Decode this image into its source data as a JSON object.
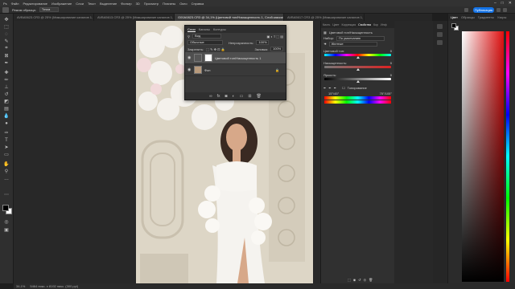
{
  "menu_bar": {
    "items": [
      "Ps",
      "Файл",
      "Редактирование",
      "Изображение",
      "Слои",
      "Текст",
      "Выделение",
      "Фильтр",
      "3D",
      "Просмотр",
      "Плагины",
      "Окно",
      "Справка"
    ]
  },
  "options_bar": {
    "mode_label": "Режим образца:",
    "mode_value": "Точка",
    "publish_label": "Публикация"
  },
  "tabs": [
    {
      "label": "AVBA5623.CR3 @ 25% (Микширование каналов 1, Слой-маска/16) *",
      "active": false
    },
    {
      "label": "AVBA5613.CR3 @ 25% (Микширование каналов 1, Слой-маска/16) *",
      "active": false
    },
    {
      "label": "G00A0823.CR3 @ 34,1% (Цветовой тон/Насыщенность 1, Слой-маска/16) *",
      "active": true
    },
    {
      "label": "AVBA5617.CR3 @ 25% (Микширование каналов 1, Слой-маска/16) *",
      "active": false
    }
  ],
  "layers_panel": {
    "tabs": [
      "Слои",
      "Каналы",
      "Контуры"
    ],
    "filter_label": "Вид",
    "blend_mode": "Обычные",
    "opacity_label": "Непрозрачность:",
    "opacity_value": "100%",
    "lock_label": "Закрепить:",
    "fill_label": "Заливка:",
    "fill_value": "100%",
    "layers": [
      {
        "name": "Цветовой тон/Насыщенность 1",
        "selected": true
      },
      {
        "name": "Фон",
        "selected": false
      }
    ]
  },
  "properties_panel": {
    "tabs": [
      "Кисть",
      "Цвет",
      "Коррекция",
      "Свойства",
      "Кор",
      "Инф"
    ],
    "title": "Цветовой тон/Насыщенность",
    "preset_label": "Набор:",
    "preset_value": "По умолчанию",
    "channel_value": "Желтые",
    "hue_label": "Цветовой тон:",
    "hue_value": "0",
    "saturation_label": "Насыщенность:",
    "saturation_value": "0",
    "lightness_label": "Яркость:",
    "lightness_value": "0",
    "colorize_label": "Тонирование",
    "range_left": "15°/45°",
    "range_right": "75°/105°"
  },
  "color_panel": {
    "tabs": [
      "Цвет",
      "Образцы",
      "Градиенты",
      "Узоры"
    ]
  },
  "status_bar": {
    "zoom": "34,1%",
    "doc_info": "5464 пикс. x 8192 пикс. (300 ppi)"
  }
}
